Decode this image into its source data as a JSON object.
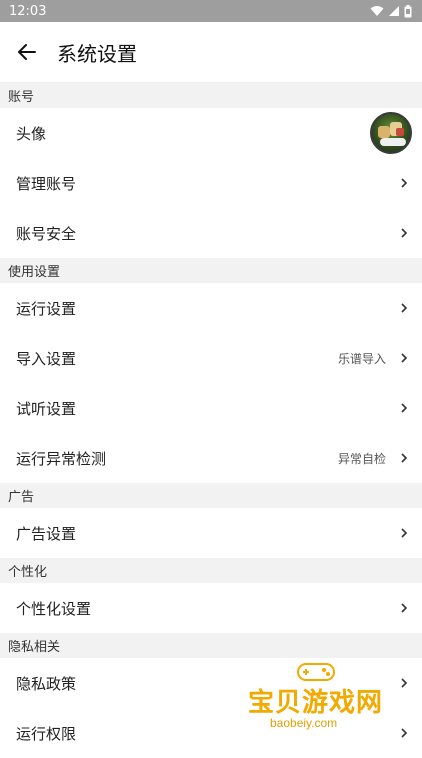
{
  "status_bar": {
    "time": "12:03",
    "icons": [
      "wifi-icon",
      "signal-icon",
      "battery-icon"
    ]
  },
  "app_bar": {
    "back_icon": "back-arrow-icon",
    "title": "系统设置"
  },
  "sections": [
    {
      "header": "账号",
      "rows": [
        {
          "label": "头像",
          "value": "",
          "trailing": "avatar"
        },
        {
          "label": "管理账号",
          "value": "",
          "trailing": "chevron"
        },
        {
          "label": "账号安全",
          "value": "",
          "trailing": "chevron"
        }
      ]
    },
    {
      "header": "使用设置",
      "rows": [
        {
          "label": "运行设置",
          "value": "",
          "trailing": "chevron"
        },
        {
          "label": "导入设置",
          "value": "乐谱导入",
          "trailing": "chevron"
        },
        {
          "label": "试听设置",
          "value": "",
          "trailing": "chevron"
        },
        {
          "label": "运行异常检测",
          "value": "异常自检",
          "trailing": "chevron"
        }
      ]
    },
    {
      "header": "广告",
      "rows": [
        {
          "label": "广告设置",
          "value": "",
          "trailing": "chevron"
        }
      ]
    },
    {
      "header": "个性化",
      "rows": [
        {
          "label": "个性化设置",
          "value": "",
          "trailing": "chevron"
        }
      ]
    },
    {
      "header": "隐私相关",
      "rows": [
        {
          "label": "隐私政策",
          "value": "",
          "trailing": "chevron"
        },
        {
          "label": "运行权限",
          "value": "",
          "trailing": "chevron"
        }
      ]
    }
  ],
  "watermark": {
    "text": "宝贝游戏网",
    "url": "baobeiy.com"
  },
  "colors": {
    "status_bar_bg": "#9e9e9e",
    "section_header_bg": "#f2f2f2",
    "watermark": "#f2a900"
  }
}
